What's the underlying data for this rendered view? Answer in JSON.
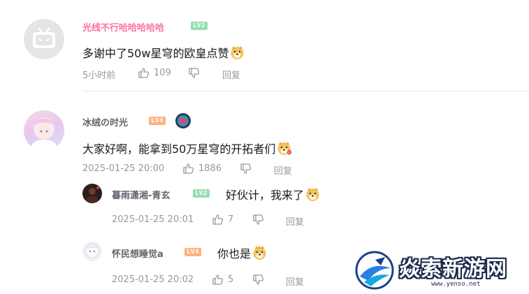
{
  "comments": [
    {
      "username": "光线不行哈哈哈哈哈",
      "level": "LV2",
      "text": "多谢中了50w星穹的欧皇点赞",
      "time": "5小时前",
      "likes": "109",
      "reply_label": "回复"
    },
    {
      "username": "冰绒の时光",
      "level": "LV4",
      "text": "大家好啊，能拿到50万星穹的开拓者们",
      "time": "2025-01-25 20:00",
      "likes": "1886",
      "reply_label": "回复",
      "replies": [
        {
          "username": "暮雨潇湘-青玄",
          "level": "LV2",
          "text": "好伙计，我来了",
          "time": "2025-01-25 20:01",
          "likes": "7",
          "reply_label": "回复"
        },
        {
          "username": "怀民想睡觉a",
          "level": "LV4",
          "text": "你也是",
          "time": "2025-01-25 20:02",
          "likes": "5",
          "reply_label": "回复"
        }
      ]
    }
  ],
  "watermark": {
    "text": "焱索新游网",
    "url": "www.yenso.net"
  },
  "colors": {
    "vip_name": "#fb7299",
    "normal_name": "#61666d",
    "lv2": "#95ddb2",
    "lv4": "#feb37f",
    "meta": "#9499a0"
  }
}
